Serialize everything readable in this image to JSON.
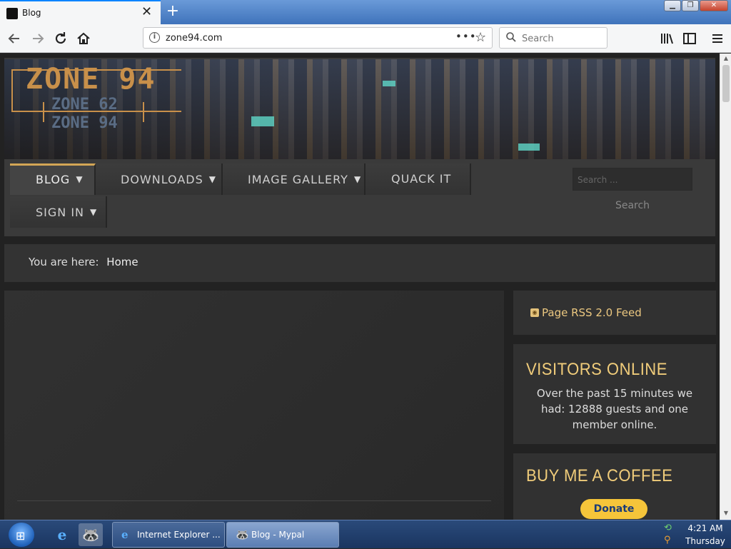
{
  "browser": {
    "tab_title": "Blog",
    "tab_close": "✕",
    "new_tab": "+",
    "url": "zone94.com",
    "url_menu": "•••",
    "search_placeholder": "Search",
    "window_buttons": {
      "minimize": "▁",
      "maximize": "❐",
      "close": "✕"
    }
  },
  "site": {
    "logo": {
      "main": "ZONE 94",
      "sub1": "ZONE 62",
      "sub2": "ZONE 94"
    },
    "menu": [
      {
        "label": "BLOG",
        "has_dropdown": true,
        "active": true
      },
      {
        "label": "DOWNLOADS",
        "has_dropdown": true,
        "active": false
      },
      {
        "label": "IMAGE GALLERY",
        "has_dropdown": true,
        "active": false
      },
      {
        "label": "QUACK IT",
        "has_dropdown": false,
        "active": false
      },
      {
        "label": "SIGN IN",
        "has_dropdown": true,
        "active": false
      }
    ],
    "caret": "▼",
    "search_placeholder": "Search ...",
    "search_button": "Search",
    "breadcrumb": {
      "prefix": "You are here:",
      "current": "Home"
    },
    "sidebar": {
      "rss": {
        "icon": "rss-icon",
        "label": "Page RSS 2.0 Feed"
      },
      "visitors": {
        "title": "VISITORS ONLINE",
        "text": "Over the past 15 minutes we had: 12888 guests and one member online."
      },
      "coffee": {
        "title": "BUY ME A COFFEE",
        "donate_label": "Donate"
      }
    }
  },
  "taskbar": {
    "tasks": [
      {
        "label": "Internet Explorer ...",
        "icon": "ie-icon",
        "active": false
      },
      {
        "label": "Blog - Mypal",
        "icon": "mypal-icon",
        "active": true
      }
    ],
    "clock_time": "4:21 AM",
    "clock_day": "Thursday"
  },
  "colors": {
    "accent_gold": "#f0cc7a",
    "menu_active_border": "#d3a656",
    "donate_bg": "#f6c53a",
    "page_bg": "#222222"
  }
}
